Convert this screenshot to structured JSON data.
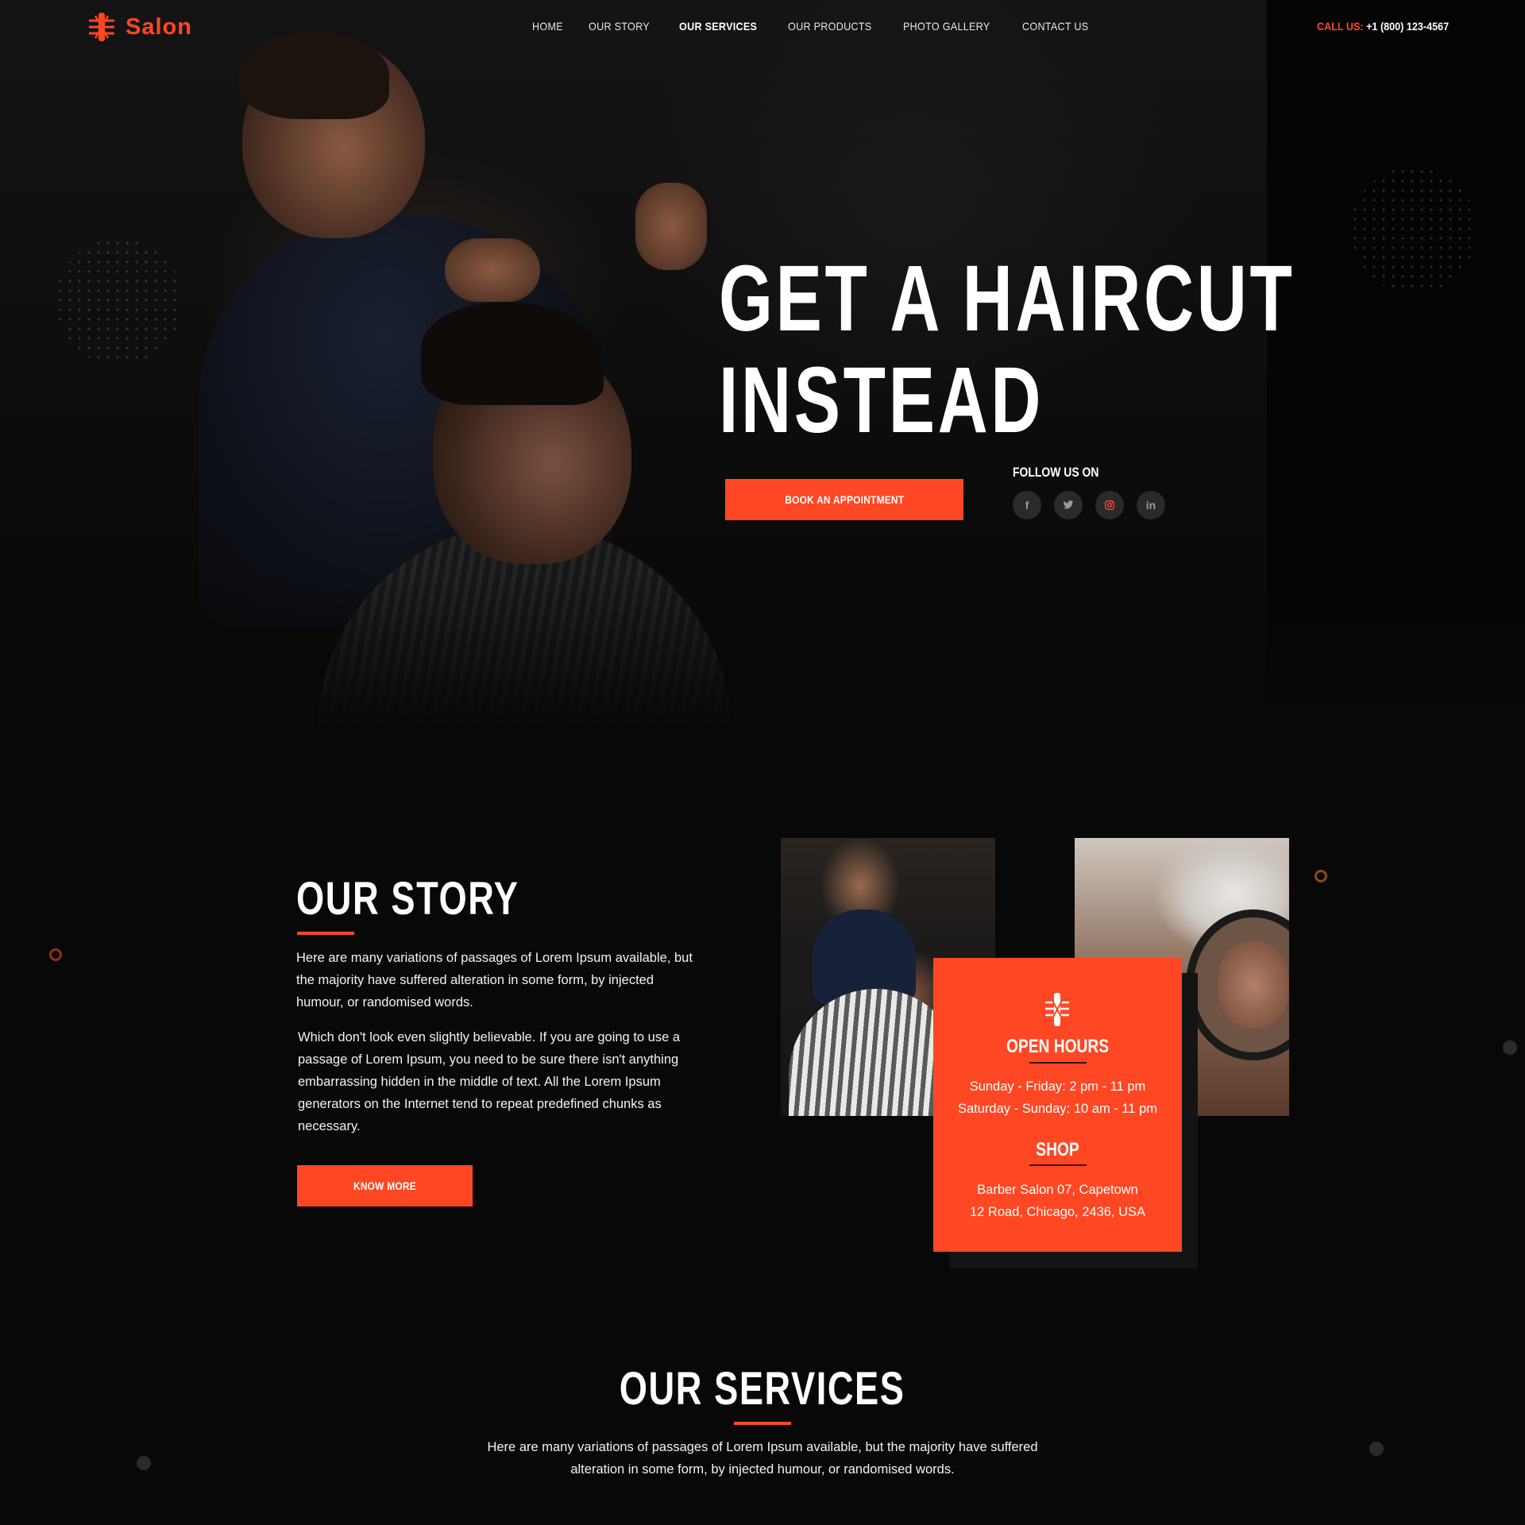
{
  "brand": {
    "name": "Salon",
    "accent": "#ff4723"
  },
  "nav": {
    "items": [
      {
        "label": "HOME"
      },
      {
        "label": "OUR STORY"
      },
      {
        "label": "OUR SERVICES",
        "active": true
      },
      {
        "label": "OUR PRODUCTS"
      },
      {
        "label": "PHOTO GALLERY"
      },
      {
        "label": "CONTACT US"
      }
    ]
  },
  "call": {
    "label": "CALL US:",
    "number": "+1 (800) 123-4567"
  },
  "hero": {
    "title_line1": "GET A HAIRCUT",
    "title_line2": "INSTEAD",
    "cta": "BOOK AN APPOINTMENT",
    "follow_label": "FOLLOW US ON",
    "socials": [
      {
        "icon": "facebook-icon",
        "glyph": "f"
      },
      {
        "icon": "twitter-icon",
        "glyph": "t"
      },
      {
        "icon": "instagram-icon",
        "glyph": "◎"
      },
      {
        "icon": "linkedin-icon",
        "glyph": "in"
      }
    ]
  },
  "story": {
    "title": "OUR STORY",
    "paragraph1": "Here are many variations of passages of Lorem Ipsum available, but the majority have suffered alteration in some form, by injected humour, or randomised words.",
    "paragraph2": "Which don't look even slightly believable. If you are going to use a passage of Lorem Ipsum, you need to be sure there isn't anything embarrassing hidden in the middle of text. All the Lorem Ipsum generators on the Internet tend to repeat predefined chunks as necessary.",
    "cta": "KNOW MORE"
  },
  "hours_card": {
    "open_title": "OPEN HOURS",
    "open_line1": "Sunday - Friday: 2 pm - 11 pm",
    "open_line2": "Saturday - Sunday: 10 am - 11 pm",
    "shop_title": "SHOP",
    "shop_line1": "Barber Salon 07, Capetown",
    "shop_line2": "12 Road, Chicago, 2436, USA"
  },
  "services": {
    "title": "OUR SERVICES",
    "paragraph": "Here are many variations of passages of Lorem Ipsum available, but the majority have suffered alteration in some form, by injected humour, or randomised words."
  }
}
